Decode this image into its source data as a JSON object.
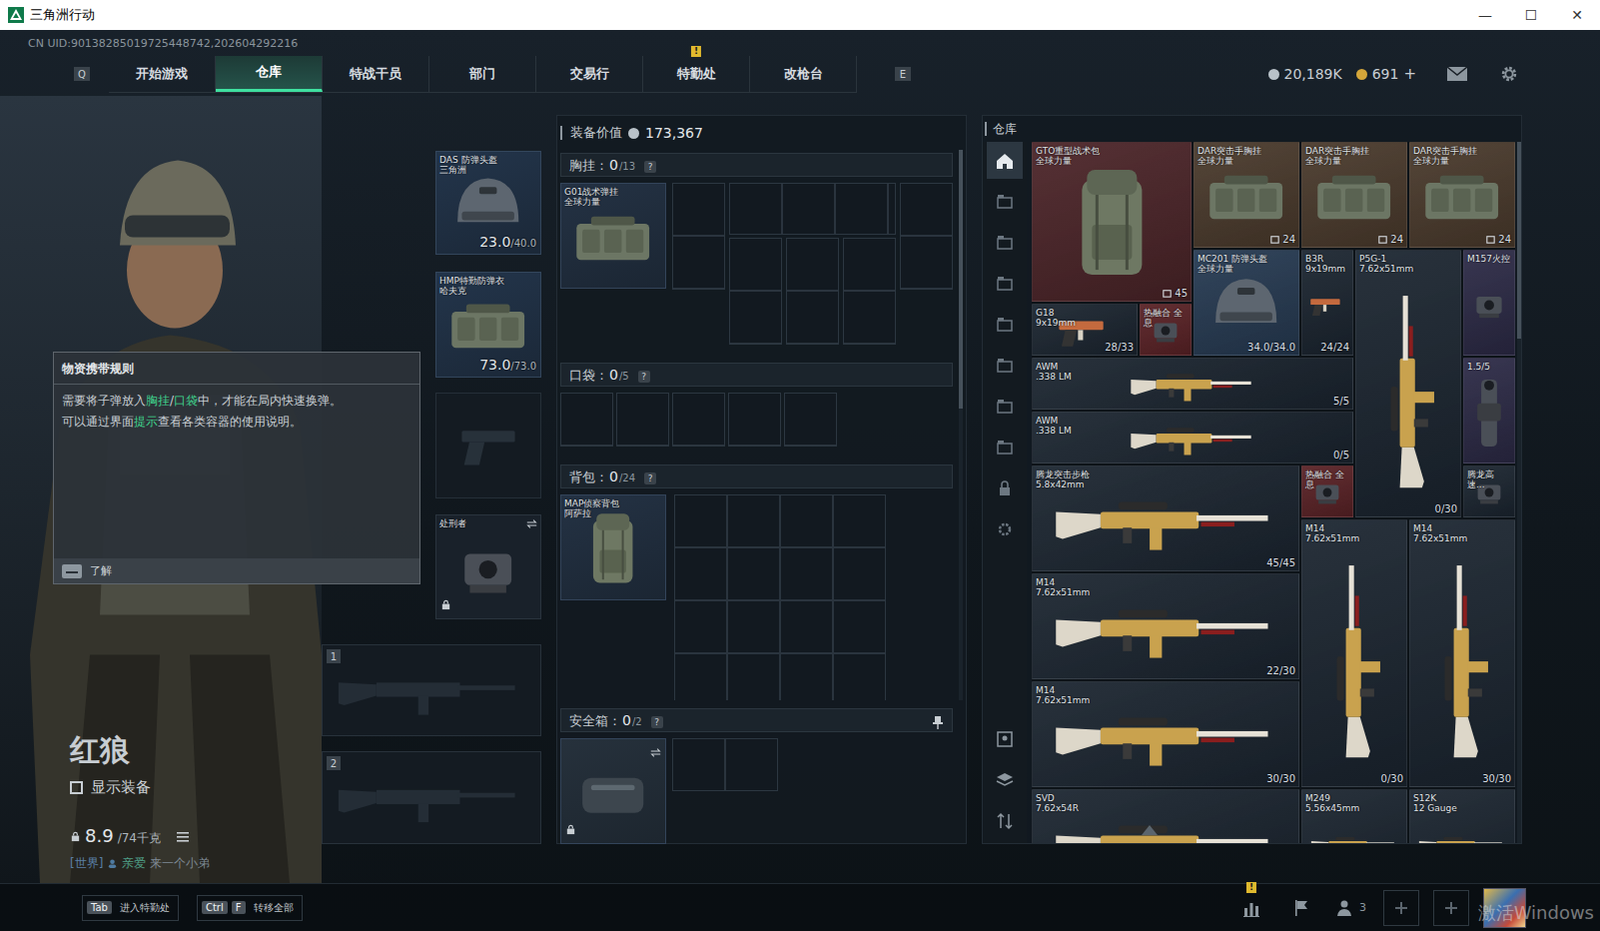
{
  "window": {
    "title": "三角洲行动",
    "controls": [
      "—",
      "☐",
      "✕"
    ]
  },
  "uid": "CN UID:90138285019725448742,202604292216",
  "nav": {
    "prev_key": "Q",
    "next_key": "E",
    "alert_mark": "!",
    "tabs": [
      {
        "label": "开始游戏",
        "selected": false,
        "alert": false
      },
      {
        "label": "仓库",
        "selected": true,
        "alert": false
      },
      {
        "label": "特战干员",
        "selected": false,
        "alert": false
      },
      {
        "label": "部门",
        "selected": false,
        "alert": false
      },
      {
        "label": "交易行",
        "selected": false,
        "alert": false
      },
      {
        "label": "特勤处",
        "selected": false,
        "alert": true
      },
      {
        "label": "改枪台",
        "selected": false,
        "alert": false
      }
    ],
    "currency": [
      {
        "kind": "silver",
        "amount": "20,189K"
      },
      {
        "kind": "gold",
        "amount": "691",
        "add": "+"
      }
    ]
  },
  "operator": {
    "name": "红狼",
    "show_gear": {
      "label": "显示装备",
      "checked": false
    },
    "weight": "8.9",
    "weight_max": "/74千克",
    "chat": {
      "channel": "[世界]",
      "user": "亲爱",
      "message": "来一个小弟"
    }
  },
  "tooltip": {
    "title": "物资携带规则",
    "lines": [
      [
        {
          "text": "需要将子弹放入",
          "highlight": false
        },
        {
          "text": "胸挂",
          "highlight": true
        },
        {
          "text": "/",
          "highlight": false
        },
        {
          "text": "口袋",
          "highlight": true
        },
        {
          "text": "中，才能在局内快速换弹。",
          "highlight": false
        }
      ],
      [
        {
          "text": "可以通过界面",
          "highlight": false
        },
        {
          "text": "提示",
          "highlight": true
        },
        {
          "text": "查看各类容器的使用说明。",
          "highlight": false
        }
      ]
    ],
    "button": "了解"
  },
  "loadout": {
    "helmet": {
      "name": "DAS 防弹头盔",
      "sub": "三角洲",
      "durability": "23.0",
      "durability_max": "/40.0"
    },
    "armor": {
      "name": "HMP特勤防弹衣",
      "sub": "哈夫克",
      "durability": "73.0",
      "durability_max": "/73.0"
    },
    "pistol": {
      "empty": true
    },
    "knife": {
      "name": "处刑者",
      "locked": true
    },
    "weapons": [
      {
        "slot": "1",
        "empty": true
      },
      {
        "slot": "2",
        "empty": true
      }
    ]
  },
  "gear_value": {
    "label": "装备价值",
    "value": "173,367"
  },
  "containers": {
    "scroll_thumb": 0.47,
    "chest": {
      "label": "胸挂：",
      "used": "0",
      "capacity": "/13",
      "help": "?",
      "item": {
        "name": "G01战术弹挂",
        "sub": "全球力量"
      }
    },
    "pocket": {
      "label": "口袋：",
      "used": "0",
      "capacity": "/5",
      "help": "?"
    },
    "backpack": {
      "label": "背包：",
      "used": "0",
      "capacity": "/24",
      "help": "?",
      "item": {
        "name": "MAP侦察背包",
        "sub": "阿萨拉"
      }
    },
    "safe": {
      "label": "安全箱：",
      "used": "0",
      "capacity": "/2",
      "help": "?",
      "locked": true
    }
  },
  "warehouse": {
    "title": "仓库",
    "scroll_thumb": 0.28,
    "side_tabs": [
      {
        "kind": "home",
        "selected": true
      },
      {
        "kind": "stash",
        "selected": false
      },
      {
        "kind": "stash",
        "selected": false
      },
      {
        "kind": "stash",
        "selected": false
      },
      {
        "kind": "stash",
        "selected": false
      },
      {
        "kind": "stash",
        "selected": false
      },
      {
        "kind": "stash",
        "selected": false
      },
      {
        "kind": "stash",
        "selected": false
      },
      {
        "kind": "lock",
        "selected": false
      },
      {
        "kind": "gear",
        "selected": false
      }
    ],
    "side_tools": [
      {
        "kind": "portrait"
      },
      {
        "kind": "layers"
      },
      {
        "kind": "sort"
      }
    ],
    "items": [
      {
        "kind": "pack",
        "name": "GTO重型战术包",
        "sub": "全球力量",
        "count": "45",
        "color": "#4b2428"
      },
      {
        "kind": "vest",
        "name": "DAR突击手胸挂",
        "sub": "全球力量",
        "count": "24",
        "color": "#4a3a2c"
      },
      {
        "kind": "vest",
        "name": "DAR突击手胸挂",
        "sub": "全球力量",
        "count": "24",
        "color": "#4a3a2c"
      },
      {
        "kind": "vest",
        "name": "DAR突击手胸挂",
        "sub": "全球力量",
        "count": "24",
        "color": "#4a3a2c"
      },
      {
        "kind": "helmet",
        "name": "MC201 防弹头盔",
        "sub": "全球力量",
        "reading": "34.0/34.0",
        "color": "#263a52"
      },
      {
        "kind": "pistol",
        "name": "B3R",
        "sub": "9x19mm",
        "reading": "24/24",
        "color": "#1b2530"
      },
      {
        "kind": "rifle-vertical",
        "name": "P5G-1",
        "sub": "7.62x51mm",
        "reading": "0/30",
        "color": "#1b2530"
      },
      {
        "kind": "sight",
        "name": "M157火控",
        "color": "#2c2a46"
      },
      {
        "kind": "pistol",
        "name": "G18",
        "sub": "9x19mm",
        "reading": "28/33",
        "color": "#1b2530"
      },
      {
        "kind": "sight",
        "name": "热融合 全息",
        "color": "#5a2226"
      },
      {
        "kind": "rifle",
        "name": "AWM",
        "sub": ".338 LM",
        "reading": "5/5",
        "color": "#1b2530"
      },
      {
        "kind": "scope",
        "name": "1.5/5",
        "color": "#2c2a46"
      },
      {
        "kind": "rifle",
        "name": "AWM",
        "sub": ".338 LM",
        "reading": "0/5",
        "color": "#1b2530"
      },
      {
        "kind": "rifle",
        "name": "腾龙突击步枪",
        "sub": "5.8x42mm",
        "reading": "45/45",
        "color": "#1b2530"
      },
      {
        "kind": "sight",
        "name": "热融合 全息",
        "color": "#5a2226"
      },
      {
        "kind": "sight",
        "name": "腾龙高速...",
        "color": "#1b2530"
      },
      {
        "kind": "rifle-vertical",
        "name": "M14",
        "sub": "7.62x51mm",
        "reading": "0/30",
        "color": "#1b2530"
      },
      {
        "kind": "rifle-vertical",
        "name": "M14",
        "sub": "7.62x51mm",
        "reading": "30/30",
        "color": "#1b2530"
      },
      {
        "kind": "rifle",
        "name": "M14",
        "sub": "7.62x51mm",
        "reading": "22/30",
        "color": "#1b2530"
      },
      {
        "kind": "rifle",
        "name": "M14",
        "sub": "7.62x51mm",
        "reading": "30/30",
        "color": "#1b2530"
      },
      {
        "kind": "rifle",
        "name": "SVD",
        "sub": "7.62x54R",
        "color": "#1b2530"
      },
      {
        "kind": "rifle",
        "name": "M249",
        "sub": "5.56x45mm",
        "color": "#1b2530"
      },
      {
        "kind": "rifle",
        "name": "S12K",
        "sub": "12 Gauge",
        "color": "#1b2530"
      }
    ]
  },
  "bottom": {
    "hints": [
      {
        "keys": [
          "Tab"
        ],
        "label": "进入特勤处"
      },
      {
        "keys": [
          "Ctrl",
          "F"
        ],
        "label": "转移全部"
      }
    ],
    "alert_mark": "!",
    "friends": "3",
    "watermark": "激活Windows"
  }
}
